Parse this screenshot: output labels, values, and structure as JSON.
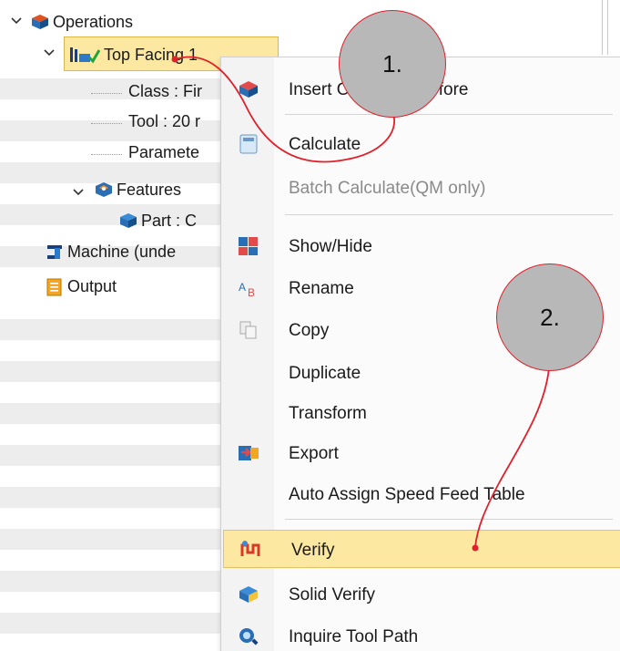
{
  "tree": {
    "operations_label": "Operations",
    "top_facing_label": "Top Facing 1",
    "class_label": "Class : Fir",
    "tool_label": "Tool : 20 r",
    "parameters_label": "Paramete",
    "features_label": "Features",
    "part_label": "Part : C",
    "machine_label": "Machine (unde",
    "output_label": "Output"
  },
  "context_menu": {
    "items": [
      {
        "label": "Insert Operation Before",
        "icon": "insert-operation-icon",
        "enabled": true
      },
      {
        "label": "Calculate",
        "icon": "calculator-icon",
        "enabled": true
      },
      {
        "label": "Batch Calculate(QM only)",
        "icon": "",
        "enabled": false
      },
      {
        "label": "Show/Hide",
        "icon": "show-hide-icon",
        "enabled": true
      },
      {
        "label": "Rename",
        "icon": "rename-icon",
        "enabled": true
      },
      {
        "label": "Copy",
        "icon": "copy-icon",
        "enabled": true
      },
      {
        "label": "Duplicate",
        "icon": "",
        "enabled": true
      },
      {
        "label": "Transform",
        "icon": "",
        "enabled": true
      },
      {
        "label": "Export",
        "icon": "export-icon",
        "enabled": true
      },
      {
        "label": "Auto Assign Speed Feed Table",
        "icon": "",
        "enabled": true
      },
      {
        "label": "Verify",
        "icon": "verify-icon",
        "enabled": true,
        "highlighted": true
      },
      {
        "label": "Solid Verify",
        "icon": "solid-verify-icon",
        "enabled": true
      },
      {
        "label": "Inquire Tool Path",
        "icon": "inquire-toolpath-icon",
        "enabled": true
      }
    ]
  },
  "annotations": {
    "step1": "1.",
    "step2": "2."
  },
  "colors": {
    "highlight": "#fde8a2",
    "annotation_line": "#e0202a",
    "callout_fill": "#b8b8b8"
  }
}
